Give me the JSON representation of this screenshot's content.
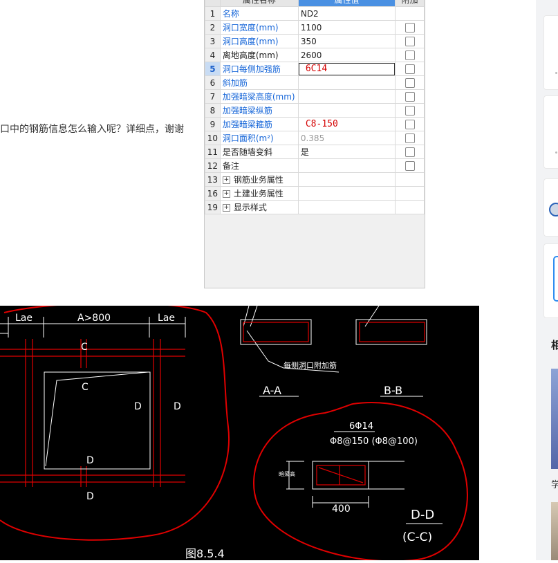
{
  "question_text": "口中的钢筋信息怎么输入呢？详细点，谢谢",
  "property_table": {
    "headers": {
      "name": "属性名称",
      "value": "属性值",
      "attach": "附加"
    },
    "rows": [
      {
        "num": "1",
        "name": "名称",
        "value": "ND2",
        "name_style": "blue",
        "checkbox": false
      },
      {
        "num": "2",
        "name": "洞口宽度(mm)",
        "value": "1100",
        "name_style": "blue",
        "checkbox": true
      },
      {
        "num": "3",
        "name": "洞口高度(mm)",
        "value": "350",
        "name_style": "blue",
        "checkbox": true
      },
      {
        "num": "4",
        "name": "离地高度(mm)",
        "value": "2600",
        "name_style": "black",
        "checkbox": true
      },
      {
        "num": "5",
        "name": "洞口每侧加强筋",
        "value": "6C14",
        "name_style": "blue",
        "checkbox": true
      },
      {
        "num": "6",
        "name": "斜加筋",
        "value": "",
        "name_style": "blue",
        "checkbox": true
      },
      {
        "num": "7",
        "name": "加强暗梁高度(mm)",
        "value": "",
        "name_style": "blue",
        "checkbox": true
      },
      {
        "num": "8",
        "name": "加强暗梁纵筋",
        "value": "",
        "name_style": "blue",
        "checkbox": true
      },
      {
        "num": "9",
        "name": "加强暗梁箍筋",
        "value": "C8-150",
        "name_style": "blue",
        "checkbox": true
      },
      {
        "num": "10",
        "name": "洞口面积(m²)",
        "value": "0.385",
        "name_style": "blue",
        "checkbox": true
      },
      {
        "num": "11",
        "name": "是否随墙变斜",
        "value": "是",
        "name_style": "black",
        "checkbox": true
      },
      {
        "num": "12",
        "name": "备注",
        "value": "",
        "name_style": "black",
        "checkbox": true
      },
      {
        "num": "13",
        "name": "钢筋业务属性",
        "value": "",
        "name_style": "group",
        "checkbox": false
      },
      {
        "num": "16",
        "name": "土建业务属性",
        "value": "",
        "name_style": "group",
        "checkbox": false
      },
      {
        "num": "19",
        "name": "显示样式",
        "value": "",
        "name_style": "group",
        "checkbox": false
      }
    ],
    "active_row": "5",
    "plus_symbol": "+"
  },
  "drawing": {
    "lae_left": "Lae",
    "dim_top": "A>800",
    "lae_right": "Lae",
    "c_top": "C",
    "c_inner": "C",
    "d_inner": "D",
    "d_right": "D",
    "d_bottom_inner": "D",
    "d_bottom_outer": "D",
    "section_aa": "A-A",
    "section_bb": "B-B",
    "callout": "每侧洞口附加筋",
    "rebar_main": "6Φ14",
    "stirrup": "Φ8@150 (Φ8@100)",
    "height_note": "暗梁高",
    "dim_400": "400",
    "section_dd": "D-D",
    "section_cc": "(C-C)",
    "figure_label": "图8.5.4"
  },
  "sidebar": {
    "heading_char": "相",
    "caption_char": "学"
  },
  "colors": {
    "accent_blue": "#4a90e2",
    "link_blue": "#1565d8",
    "rebar_red": "#d40000",
    "cad_bg": "#000000",
    "cad_annotation_red": "#e00000"
  }
}
